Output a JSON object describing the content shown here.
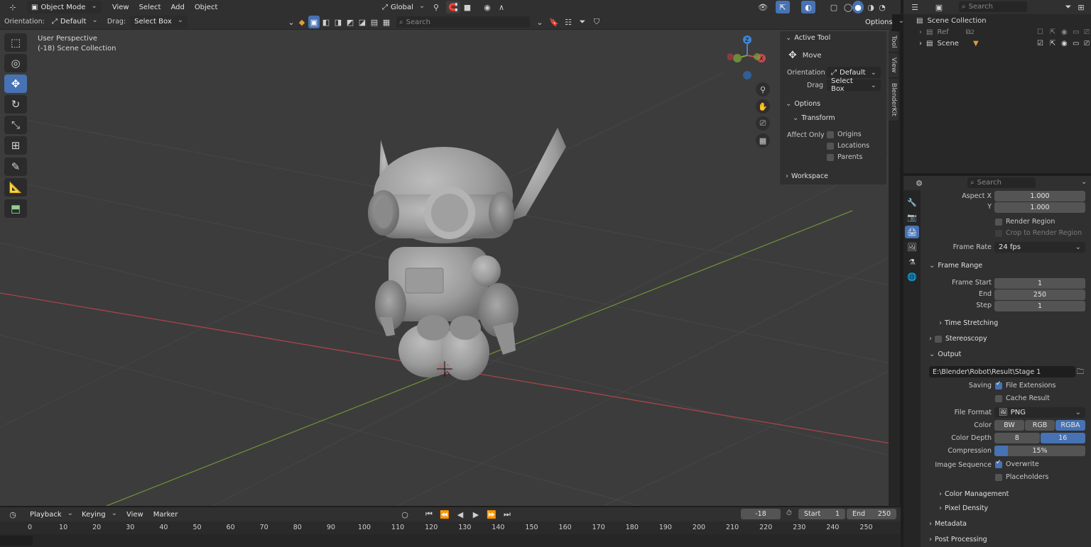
{
  "header": {
    "mode": "Object Mode",
    "menus": [
      "View",
      "Select",
      "Add",
      "Object"
    ],
    "transform_orientation": "Global",
    "orientation_label": "Orientation:",
    "orientation_value": "Default",
    "drag_label": "Drag:",
    "drag_value": "Select Box",
    "search_placeholder": "Search",
    "options_label": "Options"
  },
  "viewport": {
    "perspective": "User Perspective",
    "collection": "(-18) Scene Collection"
  },
  "npanel": {
    "active_tool_title": "Active Tool",
    "tool_name": "Move",
    "orientation_label": "Orientation",
    "orientation_value": "Default",
    "drag_label": "Drag",
    "drag_value": "Select Box",
    "options_title": "Options",
    "transform_title": "Transform",
    "affect_only_label": "Affect Only",
    "affect_origins": "Origins",
    "affect_locations": "Locations",
    "affect_parents": "Parents",
    "workspace_title": "Workspace",
    "tabs": [
      "Tool",
      "View",
      "BlenderKit"
    ]
  },
  "outliner": {
    "search_placeholder": "Search",
    "root": "Scene Collection",
    "items": [
      {
        "label": "Ref",
        "badge": "2"
      },
      {
        "label": "Scene"
      }
    ]
  },
  "properties": {
    "search_placeholder": "Search",
    "aspect_x_label": "Aspect X",
    "aspect_x": "1.000",
    "aspect_y_label": "Y",
    "aspect_y": "1.000",
    "render_region": "Render Region",
    "crop_region": "Crop to Render Region",
    "frame_rate_label": "Frame Rate",
    "frame_rate": "24 fps",
    "frame_range_title": "Frame Range",
    "frame_start_label": "Frame Start",
    "frame_start": "1",
    "end_label": "End",
    "end": "250",
    "step_label": "Step",
    "step": "1",
    "time_stretching": "Time Stretching",
    "stereoscopy": "Stereoscopy",
    "output_title": "Output",
    "output_path": "E:\\Blender\\Robot\\Result\\Stage 1",
    "saving_label": "Saving",
    "file_extensions": "File Extensions",
    "cache_result": "Cache Result",
    "file_format_label": "File Format",
    "file_format": "PNG",
    "color_label": "Color",
    "color_options": [
      "BW",
      "RGB",
      "RGBA"
    ],
    "color_depth_label": "Color Depth",
    "color_depth_options": [
      "8",
      "16"
    ],
    "compression_label": "Compression",
    "compression": "15%",
    "compression_value": 0.15,
    "image_sequence_label": "Image Sequence",
    "overwrite": "Overwrite",
    "placeholders": "Placeholders",
    "color_management": "Color Management",
    "pixel_density": "Pixel Density",
    "metadata": "Metadata",
    "post_processing": "Post Processing"
  },
  "timeline": {
    "menus": [
      "Playback",
      "Keying",
      "View",
      "Marker"
    ],
    "current_frame": "-18",
    "start_label": "Start",
    "start": "1",
    "end_label": "End",
    "end": "250",
    "ruler": [
      "0",
      "10",
      "20",
      "30",
      "40",
      "50",
      "60",
      "70",
      "80",
      "90",
      "100",
      "110",
      "120",
      "130",
      "140",
      "150",
      "160",
      "170",
      "180",
      "190",
      "200",
      "210",
      "220",
      "230",
      "240",
      "250"
    ]
  },
  "colors": {
    "accent": "#4772b3",
    "x_axis": "#c8484f",
    "y_axis": "#7da43b",
    "z_axis": "#3f84d3"
  }
}
